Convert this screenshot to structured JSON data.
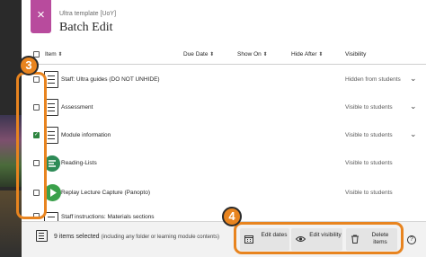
{
  "header": {
    "breadcrumb": "Ultra template [UoY]",
    "title": "Batch Edit",
    "close_icon": "×"
  },
  "table": {
    "columns": {
      "item": "Item",
      "due_date": "Due Date",
      "show_on": "Show On",
      "hide_after": "Hide After",
      "visibility": "Visibility"
    },
    "sort_glyph": "⬍",
    "rows": [
      {
        "name": "Staff: Ultra guides (DO NOT UNHIDE)",
        "visibility": "Hidden from students",
        "checked": false,
        "icon": "folder-doc-icon",
        "expand": "⌄"
      },
      {
        "name": "Assessment",
        "visibility": "Visible to students",
        "checked": false,
        "icon": "folder-doc-icon",
        "expand": "⌄"
      },
      {
        "name": "Module information",
        "visibility": "Visible to students",
        "checked": true,
        "icon": "folder-doc-icon",
        "expand": "⌄"
      },
      {
        "name": "Reading-Lists",
        "visibility": "Visible to students",
        "checked": false,
        "icon": "reading-list-icon",
        "expand": ""
      },
      {
        "name": "Replay Lecture Capture (Panopto)",
        "visibility": "Visible to students",
        "checked": false,
        "icon": "panopto-icon",
        "expand": ""
      },
      {
        "name": "Staff instructions: Materials sections",
        "visibility": "",
        "checked": false,
        "icon": "folder-doc-icon",
        "expand": ""
      }
    ]
  },
  "footer": {
    "selected_count": "9 items selected",
    "selected_sub": "(including any folder or learning module contents)",
    "actions": [
      {
        "label": "Edit dates",
        "icon": "calendar-icon"
      },
      {
        "label": "Edit visibility",
        "icon": "eye-icon"
      },
      {
        "label": "Delete items",
        "icon": "trash-icon"
      }
    ],
    "help": "?"
  },
  "annotations": {
    "step_left": "3",
    "step_right": "4",
    "color": "#e8841f"
  },
  "colors": {
    "accent_close": "#b84b9d",
    "checkbox_checked": "#2e8540"
  }
}
